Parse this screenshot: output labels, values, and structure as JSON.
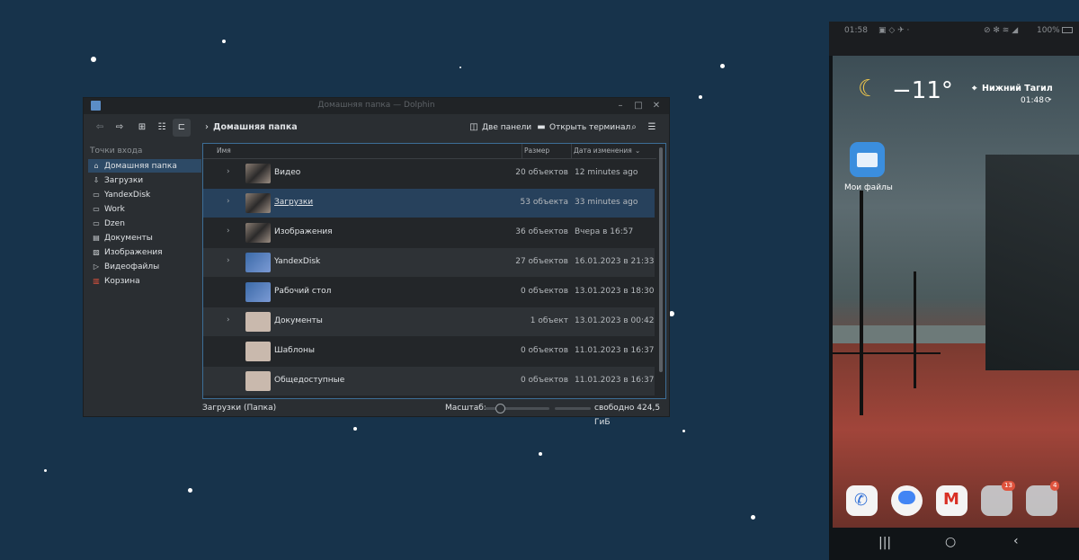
{
  "dolphin": {
    "window_title": "Домашняя папка — Dolphin",
    "breadcrumb": "Домашняя папка",
    "toolbar": {
      "split_label": "Две панели",
      "terminal_label": "Открыть терминал"
    },
    "places": {
      "header": "Точки входа",
      "items": [
        {
          "label": "Домашняя папка",
          "icon": "home-icon"
        },
        {
          "label": "Загрузки",
          "icon": "download-icon"
        },
        {
          "label": "YandexDisk",
          "icon": "drive-icon"
        },
        {
          "label": "Work",
          "icon": "folder-icon"
        },
        {
          "label": "Dzen",
          "icon": "folder-icon"
        },
        {
          "label": "Документы",
          "icon": "document-icon"
        },
        {
          "label": "Изображения",
          "icon": "image-icon"
        },
        {
          "label": "Видеофайлы",
          "icon": "video-icon"
        },
        {
          "label": "Корзина",
          "icon": "trash-icon"
        }
      ]
    },
    "columns": {
      "name": "Имя",
      "size": "Размер",
      "modified": "Дата изменения"
    },
    "rows": [
      {
        "name": "Видео",
        "size": "20 объектов",
        "date": "12 minutes ago"
      },
      {
        "name": "Загрузки",
        "size": "53 объекта",
        "date": "33 minutes ago"
      },
      {
        "name": "Изображения",
        "size": "36 объектов",
        "date": "Вчера в 16:57"
      },
      {
        "name": "YandexDisk",
        "size": "27 объектов",
        "date": "16.01.2023 в 21:33"
      },
      {
        "name": "Рабочий стол",
        "size": "0 объектов",
        "date": "13.01.2023 в 18:30"
      },
      {
        "name": "Документы",
        "size": "1 объект",
        "date": "13.01.2023 в 00:42"
      },
      {
        "name": "Шаблоны",
        "size": "0 объектов",
        "date": "11.01.2023 в 16:37"
      },
      {
        "name": "Общедоступные",
        "size": "0 объектов",
        "date": "11.01.2023 в 16:37"
      }
    ],
    "status": {
      "selection": "Загрузки (Папка)",
      "zoom_label": "Масштаб:",
      "free_space": "свободно 424,5 ГиБ"
    }
  },
  "phone": {
    "time": "01:58",
    "battery": "100%",
    "city": "Нижний Тагил",
    "temperature": "−11°",
    "clock": "01:48",
    "app_label": "Мои файлы",
    "badge1": "13",
    "badge2": "4"
  }
}
